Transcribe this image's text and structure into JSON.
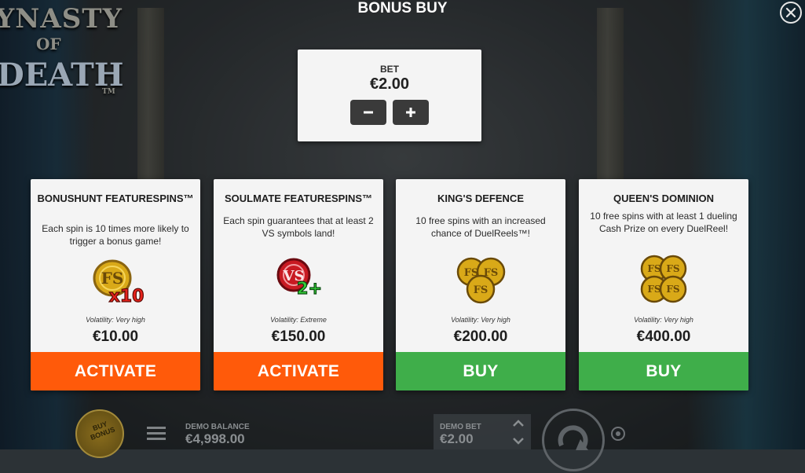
{
  "game": {
    "logo_lines": [
      "YNASTY",
      "OF",
      "DEATH",
      "TM"
    ]
  },
  "header": {
    "title": "BONUS BUY",
    "close_icon": "close-icon"
  },
  "bet": {
    "label": "BET",
    "value": "€2.00",
    "decrease_icon": "minus-icon",
    "increase_icon": "plus-icon"
  },
  "cards": [
    {
      "title": "BONUSHUNT FEATURESPINS™",
      "description": "Each spin is 10 times more likely to trigger a bonus game!",
      "icon": "fs-coin-x10-icon",
      "badge": "x10",
      "volatility": "Volatility: Very high",
      "price": "€10.00",
      "button": "ACTIVATE",
      "button_color": "#ff5a0a"
    },
    {
      "title": "SOULMATE FEATURESPINS™",
      "description": "Each spin guarantees that at least 2 VS symbols land!",
      "icon": "vs-coin-2plus-icon",
      "badge": "2+",
      "volatility": "Volatility: Extreme",
      "price": "€150.00",
      "button": "ACTIVATE",
      "button_color": "#ff5a0a"
    },
    {
      "title": "KING'S DEFENCE",
      "description": "10 free spins with an increased chance of DuelReels™!",
      "icon": "three-fs-coins-icon",
      "volatility": "Volatility: Very high",
      "price": "€200.00",
      "button": "BUY",
      "button_color": "#3fae4a"
    },
    {
      "title": "QUEEN'S DOMINION",
      "description": "10 free spins with at least 1 dueling Cash Prize on every DuelReel!",
      "icon": "four-fs-coins-icon",
      "volatility": "Volatility: Very high",
      "price": "€400.00",
      "button": "BUY",
      "button_color": "#3fae4a"
    }
  ],
  "bottom_bar": {
    "buy_bonus_label": "BUY BONUS",
    "demo_balance_label": "DEMO BALANCE",
    "demo_balance_value": "€4,998.00",
    "demo_bet_label": "DEMO BET",
    "demo_bet_value": "€2.00",
    "icons": [
      "menu-icon",
      "bet-arrows-icon",
      "spin-icon",
      "autoplay-icon"
    ]
  }
}
